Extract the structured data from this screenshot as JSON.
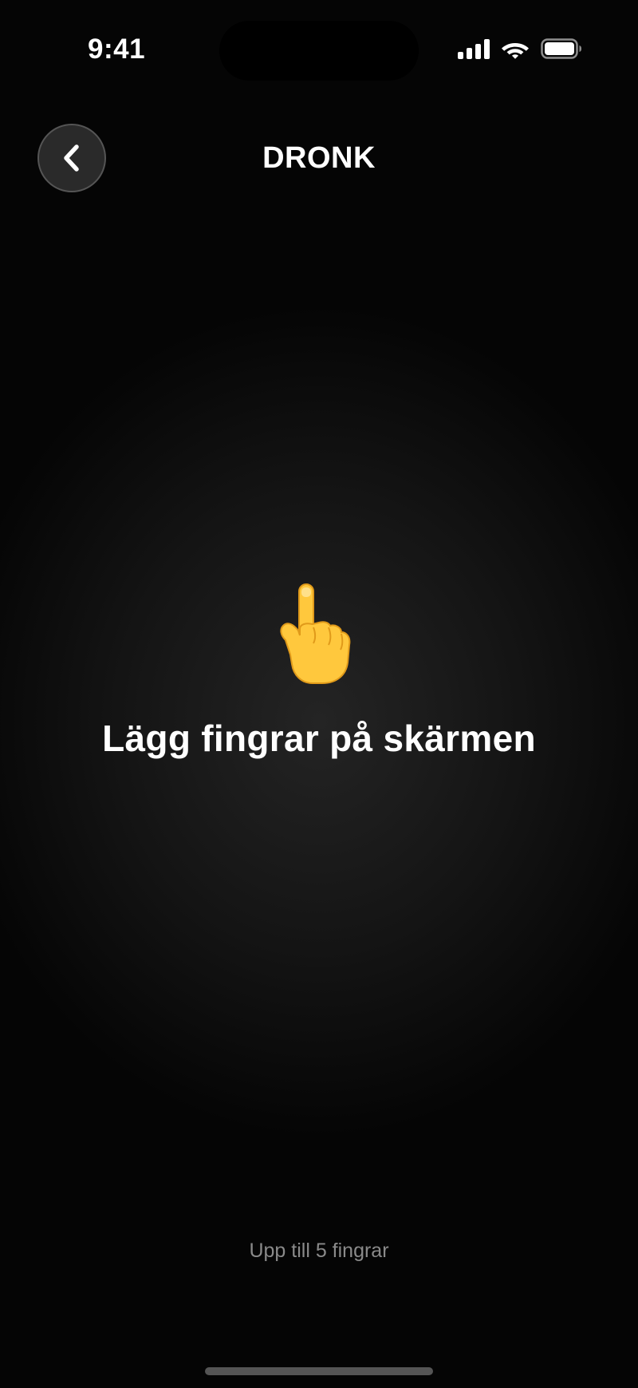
{
  "status_bar": {
    "time": "9:41",
    "icons": [
      "cellular-signal-icon",
      "wifi-icon",
      "battery-icon"
    ]
  },
  "header": {
    "back_icon": "chevron-left-icon",
    "title": "DRONK"
  },
  "main": {
    "icon": "pointing-finger-icon",
    "instruction": "Lägg fingrar på skärmen"
  },
  "footer": {
    "hint": "Upp till 5 fingrar"
  },
  "colors": {
    "background": "#000000",
    "text_primary": "#FFFFFF",
    "text_secondary": "#8A8A8A",
    "button_background": "#2A2A2A",
    "button_border": "#555555",
    "hand_yellow": "#FFC83D"
  }
}
